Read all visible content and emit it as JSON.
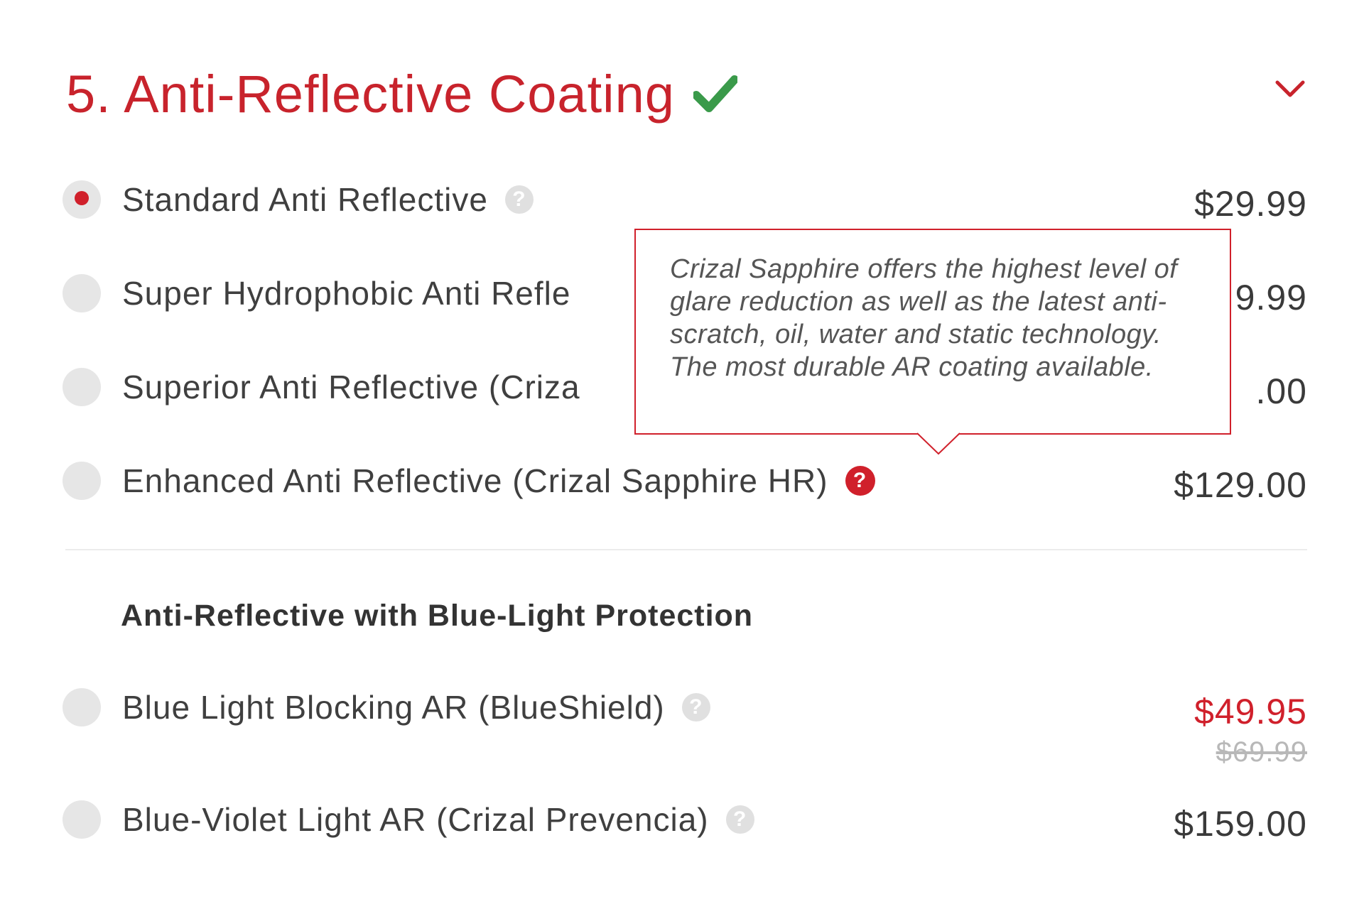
{
  "section": {
    "title": "5. Anti-Reflective Coating",
    "completed_icon": "check-icon",
    "toggle_icon": "chevron-down-icon"
  },
  "options": [
    {
      "label": "Standard Anti Reflective",
      "price": "$29.99",
      "selected": true
    },
    {
      "label": "Super Hydrophobic Anti Refle",
      "price": "9.99",
      "selected": false
    },
    {
      "label": "Superior Anti Reflective (Criza",
      "price": ".00",
      "selected": false
    },
    {
      "label": "Enhanced Anti Reflective (Crizal Sapphire HR)",
      "price": "$129.00",
      "selected": false
    }
  ],
  "blue_light": {
    "heading": "Anti-Reflective with Blue-Light Protection",
    "options": [
      {
        "label": "Blue Light Blocking AR (BlueShield)",
        "price": "$49.95",
        "old_price": "$69.99",
        "selected": false
      },
      {
        "label": "Blue-Violet Light AR (Crizal Prevencia)",
        "price": "$159.00",
        "selected": false
      }
    ]
  },
  "tooltip": {
    "text": "Crizal Sapphire offers the highest level of glare reduction as well as the latest anti-scratch, oil, water and static technology. The most durable AR coating available."
  },
  "help_glyph": "?",
  "colors": {
    "accent": "#c8232c",
    "check": "#3a9a4a",
    "radio_bg": "#e6e6e6",
    "help_bg": "#e0e0e0"
  }
}
